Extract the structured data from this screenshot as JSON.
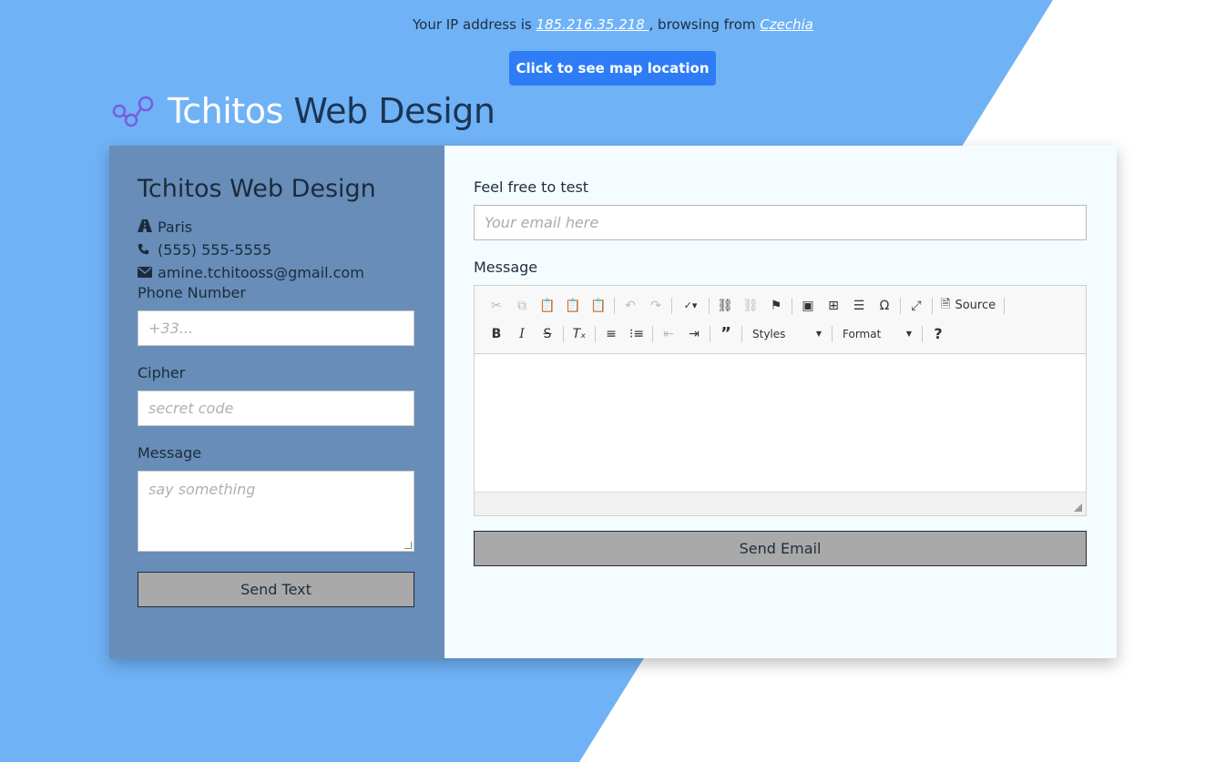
{
  "colors": {
    "background_blue": "#6fb2f6",
    "left_panel": "#678db8",
    "right_panel": "#f5fcff",
    "map_button": "#2e7df6",
    "gray_button": "#a9a9a9"
  },
  "topbar": {
    "prefix": "Your IP address is ",
    "ip": "185.216.35.218 ",
    "middle": ", browsing from ",
    "country": "Czechia"
  },
  "map_button_label": "Click to see map location",
  "brand": {
    "word1": "Tchitos",
    "word2": " Web Design",
    "icon": "molecule-icon"
  },
  "left_panel": {
    "title": "Tchitos Web Design",
    "city": "Paris",
    "phone": "(555) 555-5555",
    "email": "amine.tchitooss@gmail.com",
    "phone_label": "Phone Number",
    "phone_placeholder": "+33...",
    "cipher_label": "Cipher",
    "cipher_placeholder": "secret code",
    "message_label": "Message",
    "message_placeholder": "say something",
    "send_button": "Send Text"
  },
  "right_panel": {
    "email_label": "Feel free to test",
    "email_placeholder": "Your email here",
    "message_label": "Message",
    "toolbar": {
      "source_label": "Source",
      "styles_label": "Styles",
      "format_label": "Format"
    },
    "send_button": "Send Email"
  }
}
